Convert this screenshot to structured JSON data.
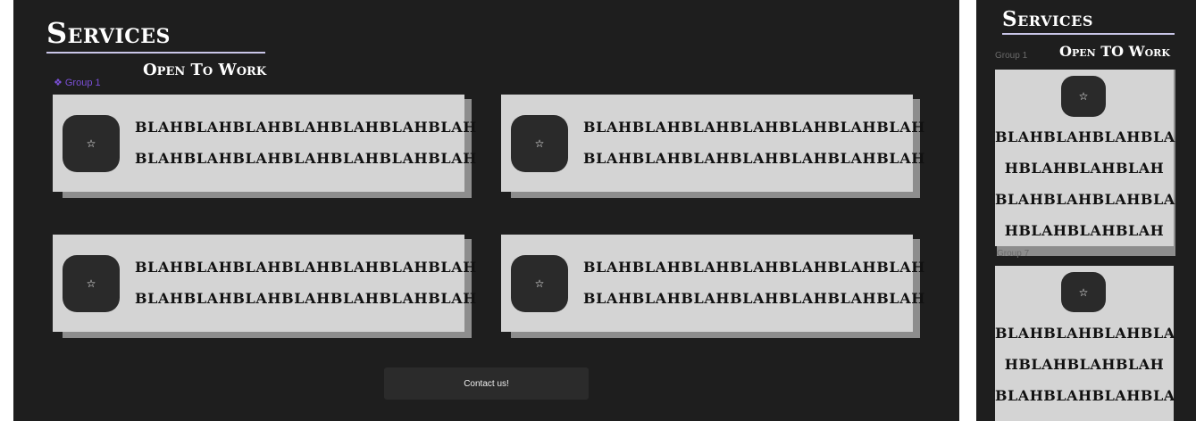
{
  "desktop": {
    "title": "Services",
    "subtitle": "Open To Work",
    "group_label": "Group 1",
    "cards": [
      {
        "line1": "BLAHBLAHBLAHBLAHBLAHBLAHBLAH",
        "line2": "BLAHBLAHBLAHBLAHBLAHBLAHBLAH",
        "icon": "star-icon"
      },
      {
        "line1": "BLAHBLAHBLAHBLAHBLAHBLAHBLAH",
        "line2": "BLAHBLAHBLAHBLAHBLAHBLAHBLAH",
        "icon": "star-icon"
      },
      {
        "line1": "BLAHBLAHBLAHBLAHBLAHBLAHBLAH",
        "line2": "BLAHBLAHBLAHBLAHBLAHBLAHBLAH",
        "icon": "star-icon"
      },
      {
        "line1": "BLAHBLAHBLAHBLAHBLAHBLAHBLAH",
        "line2": "BLAHBLAHBLAHBLAHBLAHBLAHBLAH",
        "icon": "star-icon"
      }
    ],
    "contact_label": "Contact us!"
  },
  "mobile": {
    "title": "Services",
    "subtitle": "Open TO Work",
    "group_label_top": "Group 1",
    "group_label_bottom": "Group 7",
    "cards": [
      {
        "lines": [
          "BLAHBLAHBLAHBLA",
          "HBLAHBLAHBLAH",
          "BLAHBLAHBLAHBLA",
          "HBLAHBLAHBLAH"
        ]
      },
      {
        "lines": [
          "BLAHBLAHBLAHBLA",
          "HBLAHBLAHBLAH",
          "BLAHBLAHBLAHBLA"
        ]
      }
    ]
  },
  "colors": {
    "frame_bg": "#1e1e1e",
    "card_bg": "#d4d4d4",
    "card_shadow": "#8d8d8d",
    "icon_bg": "#2a2a2a",
    "accent_underline": "#c9c6e8",
    "group_label": "#7a4fd6"
  }
}
